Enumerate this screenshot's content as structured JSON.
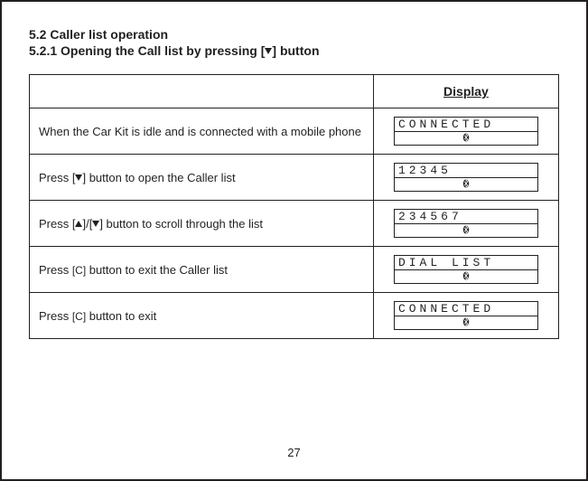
{
  "headings": {
    "h1": "5.2  Caller list operation",
    "h2_pre": "5.2.1  Opening the Call list by pressing [",
    "h2_post": "] button"
  },
  "table": {
    "header_display": "Display",
    "rows": [
      {
        "instr_plain": "When the Car Kit is idle and is connected with a mobile phone",
        "lcd_line1": "CONNECTED"
      },
      {
        "instr_pre": "Press [",
        "instr_mid_symbol": "down",
        "instr_post": "] button to open the Caller list",
        "lcd_line1": "12345"
      },
      {
        "instr_pre": "Press [",
        "instr_sym1": "up",
        "instr_between": "]/[",
        "instr_sym2": "down",
        "instr_post": "] button to scroll through the list",
        "lcd_line1": "234567"
      },
      {
        "instr_pre": "Press ",
        "instr_c": "[C]",
        "instr_post": " button to exit the Caller list",
        "lcd_line1": "DIAL  LIST"
      },
      {
        "instr_pre": "Press ",
        "instr_c": "[C]",
        "instr_post": " button to exit",
        "lcd_line1": "CONNECTED"
      }
    ]
  },
  "page_number": "27"
}
